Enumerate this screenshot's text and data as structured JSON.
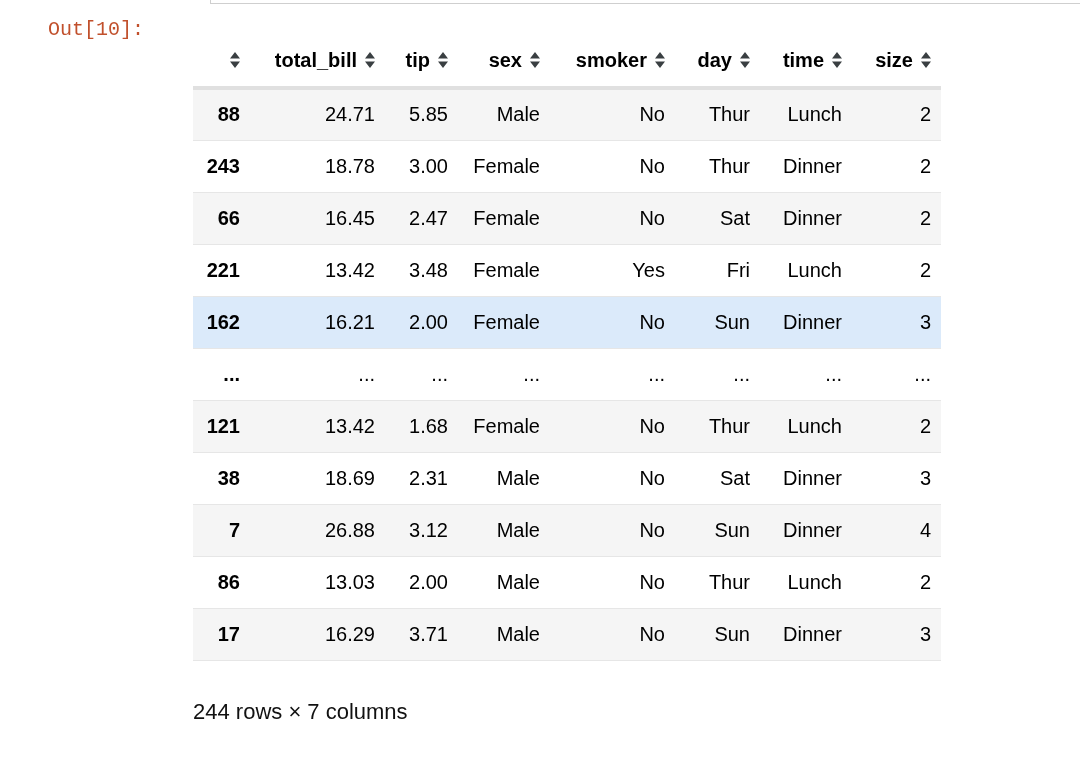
{
  "prompt": "Out[10]:",
  "table": {
    "columns": [
      "",
      "total_bill",
      "tip",
      "sex",
      "smoker",
      "day",
      "time",
      "size"
    ],
    "rows": [
      {
        "cells": [
          "88",
          "24.71",
          "5.85",
          "Male",
          "No",
          "Thur",
          "Lunch",
          "2"
        ],
        "selected": false
      },
      {
        "cells": [
          "243",
          "18.78",
          "3.00",
          "Female",
          "No",
          "Thur",
          "Dinner",
          "2"
        ],
        "selected": false
      },
      {
        "cells": [
          "66",
          "16.45",
          "2.47",
          "Female",
          "No",
          "Sat",
          "Dinner",
          "2"
        ],
        "selected": false
      },
      {
        "cells": [
          "221",
          "13.42",
          "3.48",
          "Female",
          "Yes",
          "Fri",
          "Lunch",
          "2"
        ],
        "selected": false
      },
      {
        "cells": [
          "162",
          "16.21",
          "2.00",
          "Female",
          "No",
          "Sun",
          "Dinner",
          "3"
        ],
        "selected": true
      },
      {
        "cells": [
          "...",
          "...",
          "...",
          "...",
          "...",
          "...",
          "...",
          "..."
        ],
        "selected": false
      },
      {
        "cells": [
          "121",
          "13.42",
          "1.68",
          "Female",
          "No",
          "Thur",
          "Lunch",
          "2"
        ],
        "selected": false
      },
      {
        "cells": [
          "38",
          "18.69",
          "2.31",
          "Male",
          "No",
          "Sat",
          "Dinner",
          "3"
        ],
        "selected": false
      },
      {
        "cells": [
          "7",
          "26.88",
          "3.12",
          "Male",
          "No",
          "Sun",
          "Dinner",
          "4"
        ],
        "selected": false
      },
      {
        "cells": [
          "86",
          "13.03",
          "2.00",
          "Male",
          "No",
          "Thur",
          "Lunch",
          "2"
        ],
        "selected": false
      },
      {
        "cells": [
          "17",
          "16.29",
          "3.71",
          "Male",
          "No",
          "Sun",
          "Dinner",
          "3"
        ],
        "selected": false
      }
    ]
  },
  "footer": "244 rows × 7 columns"
}
